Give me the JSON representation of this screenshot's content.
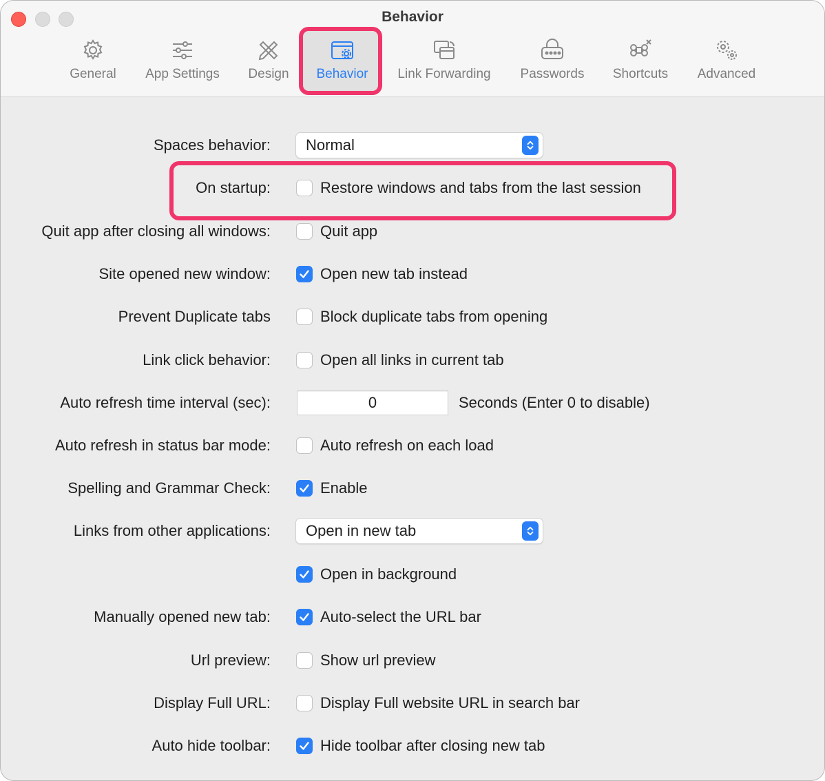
{
  "window": {
    "title": "Behavior"
  },
  "tabs": [
    {
      "label": "General",
      "icon": "gear-icon"
    },
    {
      "label": "App Settings",
      "icon": "sliders-icon"
    },
    {
      "label": "Design",
      "icon": "pencil-ruler-icon"
    },
    {
      "label": "Behavior",
      "icon": "window-gear-icon"
    },
    {
      "label": "Link Forwarding",
      "icon": "window-forward-icon"
    },
    {
      "label": "Passwords",
      "icon": "lock-icon"
    },
    {
      "label": "Shortcuts",
      "icon": "command-key-icon"
    },
    {
      "label": "Advanced",
      "icon": "gears-icon"
    }
  ],
  "active_tab": "Behavior",
  "accent_color": "#2a7ff6",
  "highlight_color": "#f0356a",
  "settings": {
    "spaces": {
      "label": "Spaces behavior:",
      "value": "Normal"
    },
    "startup": {
      "label": "On startup:",
      "option": "Restore windows and tabs from the last session",
      "checked": false
    },
    "quit": {
      "label": "Quit app after closing all windows:",
      "option": "Quit app",
      "checked": false
    },
    "site_new_window": {
      "label": "Site opened new window:",
      "option": "Open new tab instead",
      "checked": true
    },
    "dup_tabs": {
      "label": "Prevent Duplicate tabs",
      "option": "Block duplicate tabs from opening",
      "checked": false
    },
    "link_click": {
      "label": "Link click behavior:",
      "option": "Open all links in current tab",
      "checked": false
    },
    "refresh_interval": {
      "label": "Auto refresh time interval (sec):",
      "value": "0",
      "suffix": "Seconds (Enter 0 to disable)"
    },
    "refresh_status": {
      "label": "Auto refresh in status bar mode:",
      "option": "Auto refresh on each load",
      "checked": false
    },
    "spelling": {
      "label": "Spelling and Grammar Check:",
      "option": "Enable",
      "checked": true
    },
    "links_other": {
      "label": "Links from other applications:",
      "value": "Open in new tab"
    },
    "background": {
      "option": "Open in background",
      "checked": true
    },
    "manual_tab": {
      "label": "Manually opened new tab:",
      "option": "Auto-select the URL bar",
      "checked": true
    },
    "url_preview": {
      "label": "Url preview:",
      "option": "Show url preview",
      "checked": false
    },
    "full_url": {
      "label": "Display Full URL:",
      "option": "Display Full website URL in search bar",
      "checked": false
    },
    "hide_toolbar": {
      "label": "Auto hide toolbar:",
      "option": "Hide toolbar after closing new tab",
      "checked": true
    }
  }
}
